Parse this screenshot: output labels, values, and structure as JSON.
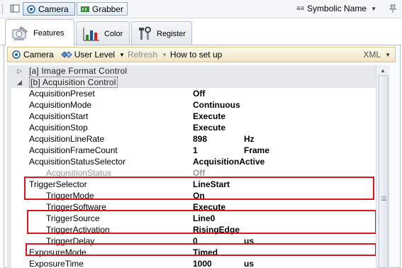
{
  "topbar": {
    "camera_label": "Camera",
    "grabber_label": "Grabber",
    "symbolic_prefix": "aa",
    "symbolic_label": "Symbolic Name"
  },
  "tabs": [
    {
      "label": "Features",
      "icon": "features-icon"
    },
    {
      "label": "Color",
      "icon": "color-chart-icon"
    },
    {
      "label": "Register",
      "icon": "register-tools-icon"
    }
  ],
  "toolbar": {
    "camera": "Camera",
    "user_level": "User Level",
    "refresh": "Refresh",
    "howto": "How to set up",
    "xml": "XML"
  },
  "groups": {
    "image_format": "[a] Image Format Control",
    "acquisition": "[b] Acquisition Control"
  },
  "rows": [
    {
      "name": "AcquisitionPreset",
      "value": "Off",
      "unit": ""
    },
    {
      "name": "AcquisitionMode",
      "value": "Continuous",
      "unit": ""
    },
    {
      "name": "AcquisitionStart",
      "value": "Execute",
      "unit": ""
    },
    {
      "name": "AcquisitionStop",
      "value": "Execute",
      "unit": ""
    },
    {
      "name": "AcquisitionLineRate",
      "value": "898",
      "unit": "Hz"
    },
    {
      "name": "AcquisitionFrameCount",
      "value": "1",
      "unit": "Frame"
    },
    {
      "name": "AcquisitionStatusSelector",
      "value": "AcquisitionActive",
      "unit": ""
    },
    {
      "name": "AcquisitionStatus",
      "value": "Off",
      "unit": ""
    },
    {
      "name": "TriggerSelector",
      "value": "LineStart",
      "unit": ""
    },
    {
      "name": "TriggerMode",
      "value": "On",
      "unit": ""
    },
    {
      "name": "TriggerSoftware",
      "value": "Execute",
      "unit": ""
    },
    {
      "name": "TriggerSource",
      "value": "Line0",
      "unit": ""
    },
    {
      "name": "TriggerActivation",
      "value": "RisingEdge",
      "unit": ""
    },
    {
      "name": "TriggerDelay",
      "value": "0",
      "unit": "us"
    },
    {
      "name": "ExposureMode",
      "value": "Timed",
      "unit": ""
    },
    {
      "name": "ExposureTime",
      "value": "1000",
      "unit": "us"
    }
  ],
  "colors": {
    "highlight": "#e0141e",
    "toolbar_bg": "#f1e4c2",
    "group_bg": "#e6e8ec"
  }
}
